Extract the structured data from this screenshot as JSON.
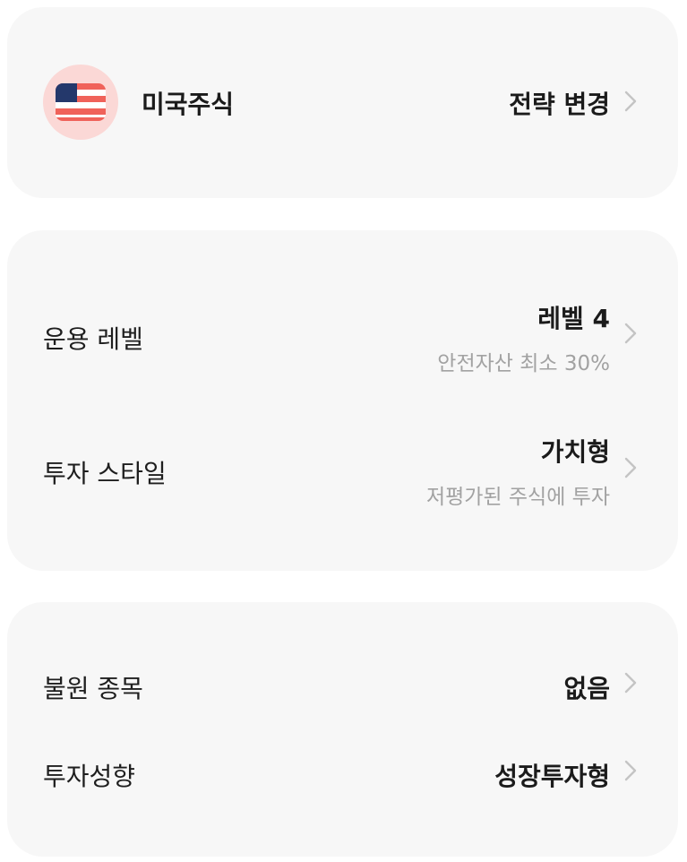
{
  "market": {
    "name": "미국주식",
    "flag_icon": "us-flag-icon",
    "action_label": "전략 변경"
  },
  "strategy": {
    "level": {
      "label": "운용 레벨",
      "value": "레벨 4",
      "description": "안전자산 최소 30%"
    },
    "style": {
      "label": "투자 스타일",
      "value": "가치형",
      "description": "저평가된 주식에 투자"
    }
  },
  "options": {
    "excluded": {
      "label": "불원 종목",
      "value": "없음"
    },
    "tendency": {
      "label": "투자성향",
      "value": "성장투자형"
    }
  },
  "colors": {
    "card_background": "#f7f7f7",
    "flag_badge_background": "#fbd8d6",
    "flag_blue": "#24386b",
    "flag_red": "#f0625a",
    "secondary_text": "#a2a2a2",
    "chevron": "#c4c4c4"
  }
}
